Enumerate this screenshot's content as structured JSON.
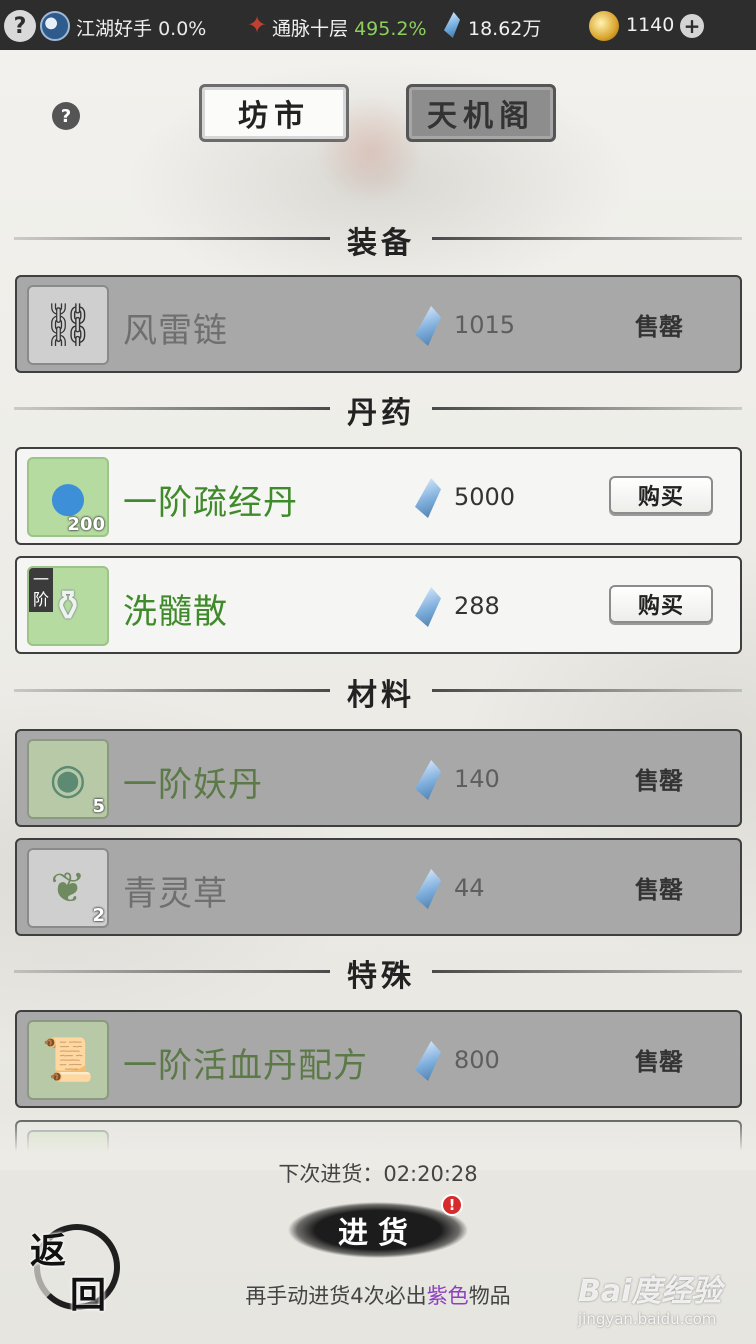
{
  "status_bar": {
    "help_glyph": "?",
    "rank_label": "江湖好手",
    "rank_pct": "0.0%",
    "realm_label": "通脉十层",
    "realm_pct": "495.2%",
    "spirit_stones": "18.62万",
    "coins": "1140",
    "add_glyph": "+"
  },
  "help_glyph": "?",
  "tabs": [
    {
      "label": "坊市",
      "active": true
    },
    {
      "label": "天机阁",
      "active": false
    }
  ],
  "sections": [
    {
      "title": "装备",
      "items": [
        {
          "name": "风雷链",
          "price": "1015",
          "status": "售罄",
          "qty": "",
          "tier": ""
        }
      ]
    },
    {
      "title": "丹药",
      "items": [
        {
          "name": "一阶疏经丹",
          "price": "5000",
          "status": "购买",
          "qty": "200",
          "tier": ""
        },
        {
          "name": "洗髓散",
          "price": "288",
          "status": "购买",
          "qty": "",
          "tier": "一阶"
        }
      ]
    },
    {
      "title": "材料",
      "items": [
        {
          "name": "一阶妖丹",
          "price": "140",
          "status": "售罄",
          "qty": "5",
          "tier": ""
        },
        {
          "name": "青灵草",
          "price": "44",
          "status": "售罄",
          "qty": "2",
          "tier": ""
        }
      ]
    },
    {
      "title": "特殊",
      "items": [
        {
          "name": "一阶活血丹配方",
          "price": "800",
          "status": "售罄",
          "qty": "",
          "tier": ""
        }
      ]
    }
  ],
  "restock": {
    "timer_label": "下次进货：",
    "timer_value": "02:20:28",
    "button_label": "进货",
    "hint_prefix": "再手动进货4次必出",
    "hint_highlight": "紫色",
    "hint_suffix": "物品"
  },
  "back_button": {
    "char1": "返",
    "char2": "回"
  },
  "watermark": {
    "line1": "Bai度经验",
    "line2": "jingyan.baidu.com"
  },
  "colors": {
    "accent_green": "#3f8a2a",
    "realm_green": "#8ccf5a",
    "highlight_purple": "#8e3fc0",
    "alert_red": "#d72a2a"
  },
  "icons": {
    "top": [
      "help-icon",
      "taiji-icon",
      "meridian-icon",
      "spirit-crystal-icon",
      "coin-icon",
      "plus-icon"
    ],
    "items": [
      "chain-weapon-icon",
      "pill-orb-icon",
      "potion-flask-icon",
      "demon-core-icon",
      "herb-leaf-icon",
      "recipe-scroll-icon"
    ]
  }
}
